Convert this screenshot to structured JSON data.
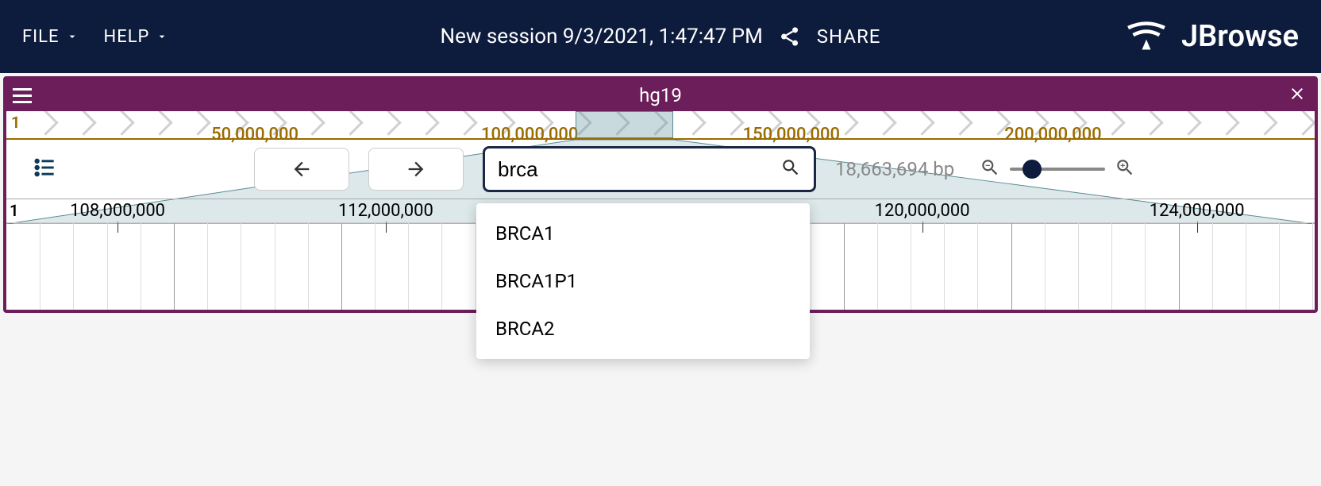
{
  "topbar": {
    "menus": [
      "FILE",
      "HELP"
    ],
    "session_title": "New session 9/3/2021, 1:47:47 PM",
    "share_label": "SHARE",
    "brand": "JBrowse"
  },
  "view": {
    "assembly": "hg19",
    "chromosome": "1",
    "overview_ticks": [
      {
        "pos_pct": 19,
        "label": "50,000,000"
      },
      {
        "pos_pct": 40,
        "label": "100,000,000"
      },
      {
        "pos_pct": 60,
        "label": "150,000,000"
      },
      {
        "pos_pct": 80,
        "label": "200,000,000"
      }
    ],
    "overview_highlight": {
      "left_pct": 43.5,
      "width_pct": 7.5
    },
    "search_value": "brca",
    "bp_span": "18,663,694 bp",
    "detail_chr": "1",
    "detail_ticks": [
      {
        "pos_pct": 8.5,
        "label": "108,000,000"
      },
      {
        "pos_pct": 29,
        "label": "112,000,000"
      },
      {
        "pos_pct": 70,
        "label": "120,000,000"
      },
      {
        "pos_pct": 91,
        "label": "124,000,000"
      }
    ]
  },
  "autocomplete": {
    "items": [
      "BRCA1",
      "BRCA1P1",
      "BRCA2"
    ]
  }
}
